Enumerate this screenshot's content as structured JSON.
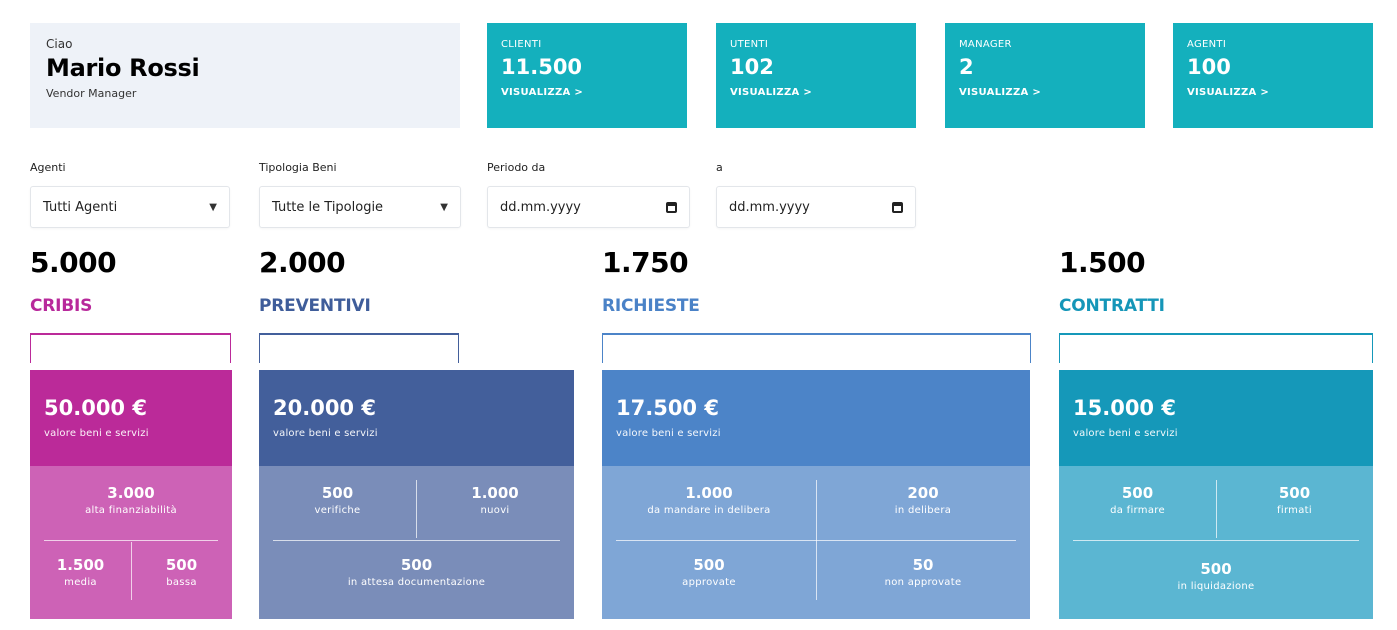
{
  "welcome": {
    "greeting": "Ciao",
    "name": "Mario Rossi",
    "role": "Vendor Manager"
  },
  "stats": [
    {
      "label": "CLIENTI",
      "value": "11.500",
      "link": "VISUALIZZA >"
    },
    {
      "label": "UTENTI",
      "value": "102",
      "link": "VISUALIZZA >"
    },
    {
      "label": "MANAGER",
      "value": "2",
      "link": "VISUALIZZA >"
    },
    {
      "label": "AGENTI",
      "value": "100",
      "link": "VISUALIZZA >"
    }
  ],
  "filters": {
    "agenti": {
      "label": "Agenti",
      "value": "Tutti Agenti"
    },
    "tipologia": {
      "label": "Tipologia Beni",
      "value": "Tutte le Tipologie"
    },
    "periodo_da": {
      "label": "Periodo da",
      "value": "dd.mm.yyyy"
    },
    "periodo_a": {
      "label": "a",
      "value": "dd.mm.yyyy"
    }
  },
  "categories": [
    {
      "count": "5.000",
      "name": "CRIBIS",
      "color": "#b8299b"
    },
    {
      "count": "2.000",
      "name": "PREVENTIVI",
      "color": "#3f5d9a"
    },
    {
      "count": "1.750",
      "name": "RICHIESTE",
      "color": "#4a82c7"
    },
    {
      "count": "1.500",
      "name": "CONTRATTI",
      "color": "#1596b8"
    }
  ],
  "panels": {
    "cribis": {
      "amount": "50.000 €",
      "sub": "valore beni e servizi",
      "c1": {
        "n": "3.000",
        "t": "alta finanziabilità"
      },
      "c2": {
        "n": "1.500",
        "t": "media"
      },
      "c3": {
        "n": "500",
        "t": "bassa"
      }
    },
    "preventivi": {
      "amount": "20.000 €",
      "sub": "valore beni e servizi",
      "c1": {
        "n": "500",
        "t": "verifiche"
      },
      "c2": {
        "n": "1.000",
        "t": "nuovi"
      },
      "c3": {
        "n": "500",
        "t": "in attesa documentazione"
      }
    },
    "richieste": {
      "amount": "17.500 €",
      "sub": "valore beni e servizi",
      "c1": {
        "n": "1.000",
        "t": "da mandare in delibera"
      },
      "c2": {
        "n": "200",
        "t": "in delibera"
      },
      "c3": {
        "n": "500",
        "t": "approvate"
      },
      "c4": {
        "n": "50",
        "t": "non approvate"
      }
    },
    "contratti": {
      "amount": "15.000 €",
      "sub": "valore beni e servizi",
      "c1": {
        "n": "500",
        "t": "da firmare"
      },
      "c2": {
        "n": "500",
        "t": "firmati"
      },
      "c3": {
        "n": "500",
        "t": "in liquidazione"
      }
    }
  },
  "colors": {
    "stat_card": "#14b0bd",
    "cribis_top": "#bb2a99",
    "cribis_bottom": "#cd62b6",
    "preventivi_top": "#435f9b",
    "preventivi_bottom": "#7a8db9",
    "richieste_top": "#4c84c8",
    "richieste_bottom": "#7fa6d6",
    "contratti_top": "#1598b9",
    "contratti_bottom": "#5bb6d2"
  }
}
